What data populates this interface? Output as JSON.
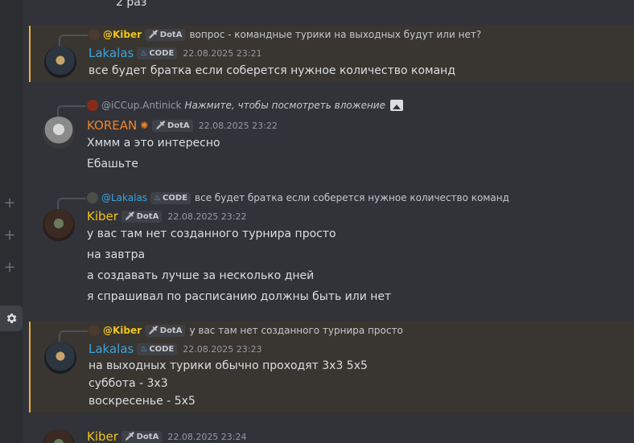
{
  "top_fragment": "2 раз",
  "colors": {
    "lakalas": "#3aa3e0",
    "korean": "#f0832c",
    "kiber": "#f0c419",
    "highlight": "#f0b232"
  },
  "messages": [
    {
      "reply": {
        "name": "@Kiber",
        "tag": "DotA",
        "text": "вопрос - командные турики на выходных будут или нет?"
      },
      "author": "Lakalas",
      "tag": "CODE",
      "time": "22.08.2025 23:21",
      "lines": [
        "все будет братка если соберется нужное количество команд"
      ]
    },
    {
      "reply": {
        "name": "@iCCup.Antinick",
        "text": "Нажмите, чтобы посмотреть вложение",
        "icon": "image-icon"
      },
      "author": "KOREAN",
      "badge": "sun-icon",
      "tag": "DotA",
      "time": "22.08.2025 23:22",
      "lines": [
        "Хммм а это интересно",
        "Ебашьте"
      ]
    },
    {
      "reply": {
        "name": "@Lakalas",
        "tag": "CODE",
        "text": "все будет братка если соберется нужное количество команд"
      },
      "author": "Kiber",
      "tag": "DotA",
      "time": "22.08.2025 23:22",
      "lines": [
        "у вас там нет созданного турнира просто",
        "на завтра",
        "а создавать лучше за несколько дней",
        "я спрашивал по расписанию должны быть или нет"
      ]
    },
    {
      "reply": {
        "name": "@Kiber",
        "tag": "DotA",
        "text": "у вас там нет созданного турнира просто"
      },
      "author": "Lakalas",
      "tag": "CODE",
      "time": "22.08.2025 23:23",
      "lines": [
        "на выходных турики обычно проходят 3х3 5х5",
        "суббота - 3х3",
        "воскресенье - 5х5"
      ]
    },
    {
      "author": "Kiber",
      "tag": "DotA",
      "time": "22.08.2025 23:24"
    }
  ]
}
